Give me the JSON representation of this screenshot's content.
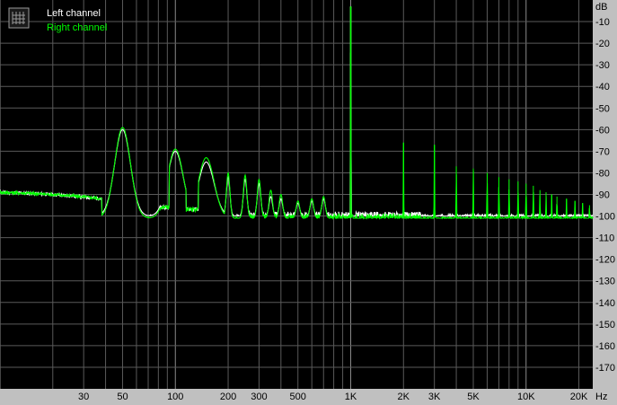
{
  "chart_data": {
    "type": "line",
    "title": "",
    "xlabel": "Hz",
    "ylabel": "dB",
    "x_scale": "log",
    "xlim": [
      10,
      24000
    ],
    "ylim": [
      -180,
      0
    ],
    "grid": true,
    "legend_placement": "top-left",
    "x_ticks": [
      {
        "value": 30,
        "label": "30"
      },
      {
        "value": 50,
        "label": "50"
      },
      {
        "value": 100,
        "label": "100"
      },
      {
        "value": 200,
        "label": "200"
      },
      {
        "value": 300,
        "label": "300"
      },
      {
        "value": 500,
        "label": "500"
      },
      {
        "value": 1000,
        "label": "1K"
      },
      {
        "value": 2000,
        "label": "2K"
      },
      {
        "value": 3000,
        "label": "3K"
      },
      {
        "value": 5000,
        "label": "5K"
      },
      {
        "value": 10000,
        "label": "10K"
      },
      {
        "value": 20000,
        "label": "20K"
      }
    ],
    "y_ticks": [
      -10,
      -20,
      -30,
      -40,
      -50,
      -60,
      -70,
      -80,
      -90,
      -100,
      -110,
      -120,
      -130,
      -140,
      -150,
      -160,
      -170
    ],
    "series": [
      {
        "name": "Left channel",
        "color": "#ffffff",
        "noise_floor": -100,
        "peaks": [
          {
            "x": 50,
            "y": -60
          },
          {
            "x": 100,
            "y": -70
          },
          {
            "x": 150,
            "y": -75
          },
          {
            "x": 200,
            "y": -82
          },
          {
            "x": 250,
            "y": -83
          },
          {
            "x": 300,
            "y": -85
          },
          {
            "x": 350,
            "y": -91
          },
          {
            "x": 400,
            "y": -92
          },
          {
            "x": 500,
            "y": -94
          },
          {
            "x": 600,
            "y": -93
          },
          {
            "x": 700,
            "y": -92
          },
          {
            "x": 1000,
            "y": -3
          }
        ]
      },
      {
        "name": "Right channel",
        "color": "#00ff00",
        "noise_floor": -101,
        "peaks": [
          {
            "x": 50,
            "y": -59
          },
          {
            "x": 100,
            "y": -69
          },
          {
            "x": 150,
            "y": -73
          },
          {
            "x": 200,
            "y": -80
          },
          {
            "x": 250,
            "y": -81
          },
          {
            "x": 300,
            "y": -83
          },
          {
            "x": 350,
            "y": -88
          },
          {
            "x": 400,
            "y": -90
          },
          {
            "x": 500,
            "y": -93
          },
          {
            "x": 600,
            "y": -92
          },
          {
            "x": 700,
            "y": -91
          },
          {
            "x": 1000,
            "y": -3
          },
          {
            "x": 2000,
            "y": -66
          },
          {
            "x": 3000,
            "y": -67
          },
          {
            "x": 4000,
            "y": -77
          },
          {
            "x": 5000,
            "y": -78
          },
          {
            "x": 6000,
            "y": -80
          },
          {
            "x": 7000,
            "y": -82
          },
          {
            "x": 8000,
            "y": -83
          },
          {
            "x": 9000,
            "y": -84
          },
          {
            "x": 10000,
            "y": -85
          },
          {
            "x": 11000,
            "y": -86
          },
          {
            "x": 12000,
            "y": -88
          },
          {
            "x": 13000,
            "y": -89
          },
          {
            "x": 14000,
            "y": -90
          },
          {
            "x": 15000,
            "y": -91
          },
          {
            "x": 17000,
            "y": -92
          },
          {
            "x": 19000,
            "y": -93
          },
          {
            "x": 21000,
            "y": -94
          },
          {
            "x": 23000,
            "y": -95
          }
        ]
      }
    ]
  }
}
